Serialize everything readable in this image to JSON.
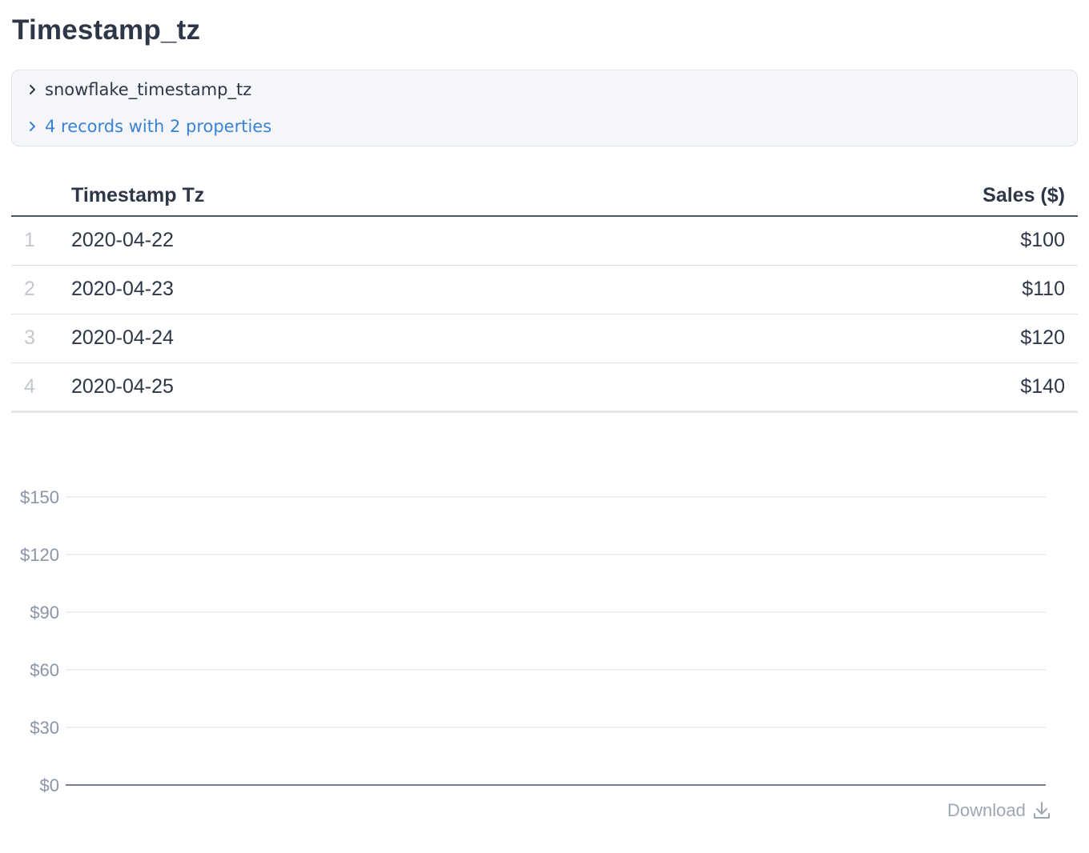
{
  "page": {
    "title": "Timestamp_tz"
  },
  "query": {
    "name": "snowflake_timestamp_tz",
    "summary": "4 records with 2 properties",
    "chevron_icon": "chevron-right-icon"
  },
  "table": {
    "headers": [
      "",
      "Timestamp Tz",
      "Sales ($)"
    ],
    "rows": [
      {
        "index": "1",
        "timestamp": "2020-04-22",
        "sales": "$100"
      },
      {
        "index": "2",
        "timestamp": "2020-04-23",
        "sales": "$110"
      },
      {
        "index": "3",
        "timestamp": "2020-04-24",
        "sales": "$120"
      },
      {
        "index": "4",
        "timestamp": "2020-04-25",
        "sales": "$140"
      }
    ]
  },
  "chart_data": {
    "type": "line",
    "x": [],
    "series": [],
    "y_ticks": [
      "$0",
      "$30",
      "$60",
      "$90",
      "$120",
      "$150"
    ],
    "ylim": [
      0,
      150
    ],
    "grid": true,
    "gridline_color": "#e2e5ea",
    "baseline_color": "#4a5568"
  },
  "download": {
    "label": "Download",
    "icon": "download-icon"
  }
}
